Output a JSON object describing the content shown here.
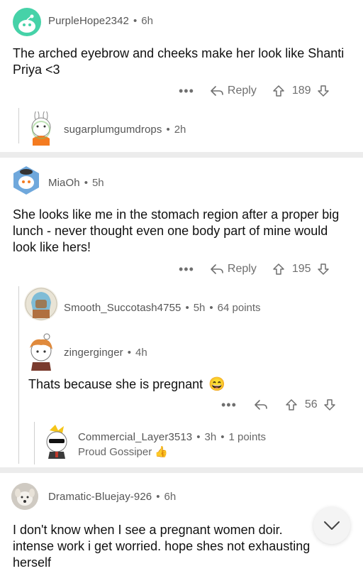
{
  "comments": [
    {
      "user": "PurpleHope2342",
      "time": "6h",
      "body": "The arched eyebrow and cheeks make her look like Shanti Priya <3",
      "votes": "189",
      "reply": "Reply"
    },
    {
      "user": "sugarplumgumdrops",
      "time": "2h"
    },
    {
      "user": "MiaOh",
      "time": "5h",
      "body": "She looks like me in the stomach region after a proper big lunch - never thought even one body part of mine would look like hers!",
      "votes": "195",
      "reply": "Reply"
    },
    {
      "user": "Smooth_Succotash4755",
      "time": "5h",
      "points": "64 points"
    },
    {
      "user": "zingerginger",
      "time": "4h",
      "body": "Thats because she is pregnant",
      "emoji": "😄",
      "votes": "56"
    },
    {
      "user": "Commercial_Layer3513",
      "time": "3h",
      "points": "1 points",
      "flair": "Proud Gossiper",
      "flair_emoji": "👍"
    },
    {
      "user": "Dramatic-Bluejay-926",
      "time": "6h",
      "body": "I don't know when I see a pregnant women doir. intense work i get worried. hope shes not exhausting herself"
    }
  ],
  "ui": {
    "dots": "•••",
    "sep": "•"
  },
  "colors": {
    "divider": "#ececec",
    "accent_green": "#3bd3a0"
  }
}
